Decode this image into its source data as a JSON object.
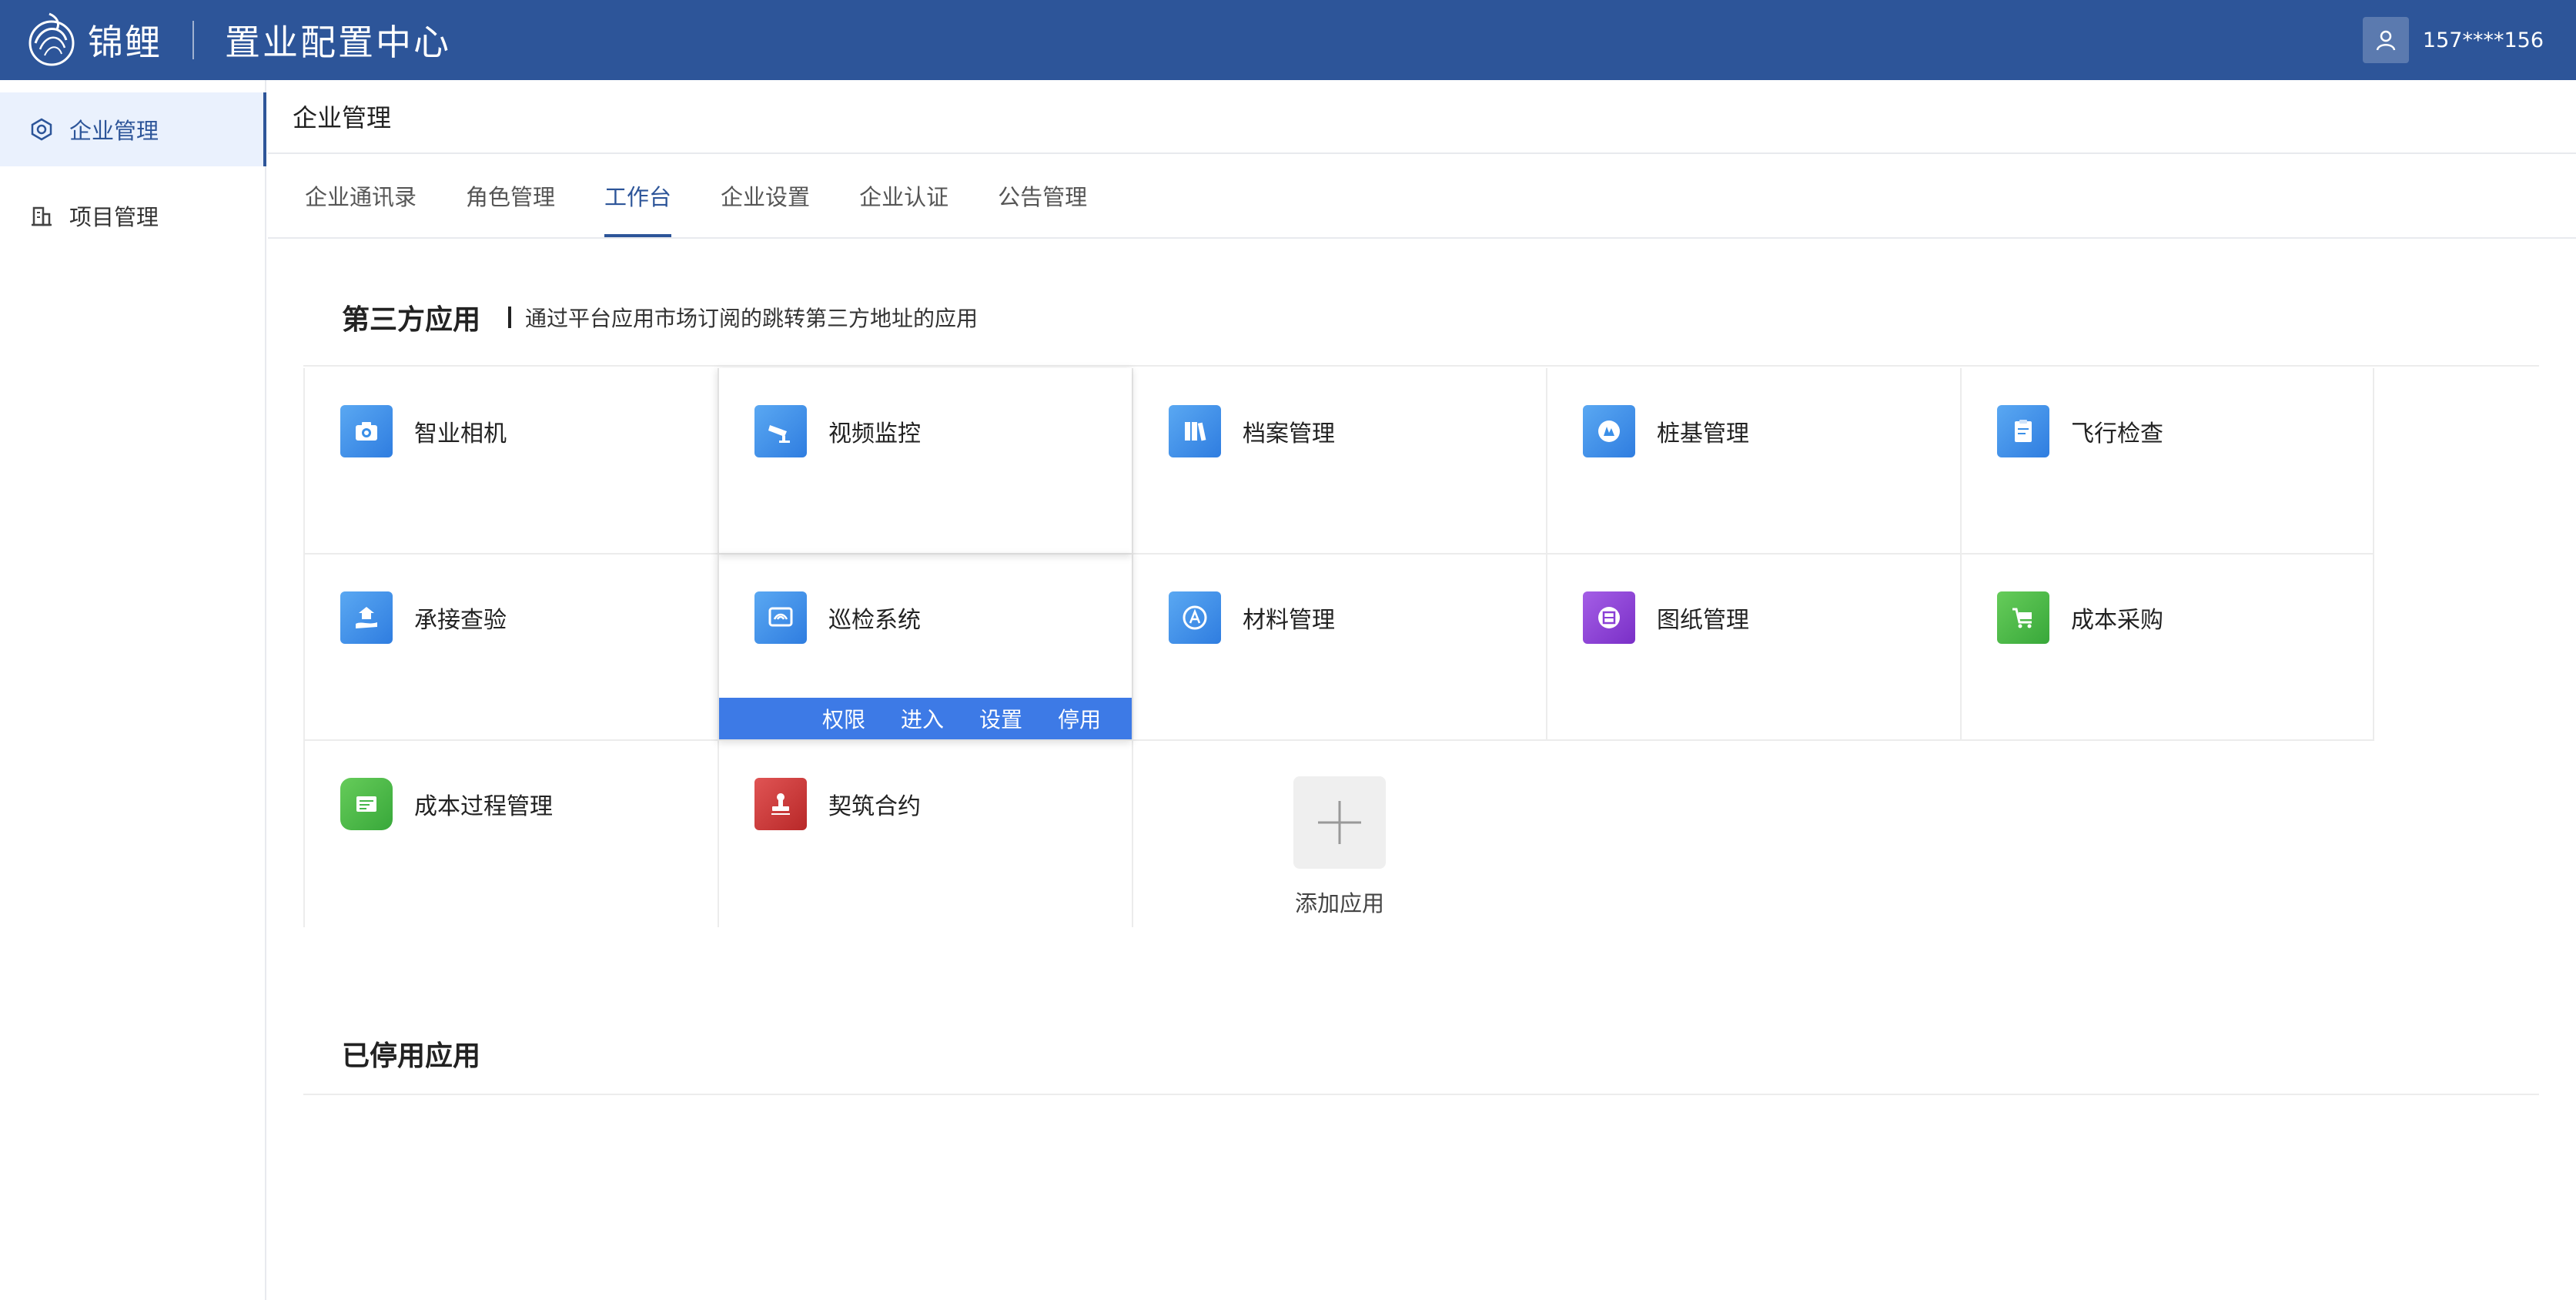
{
  "header": {
    "brand": "锦鲤",
    "system_title": "置业配置中心",
    "username": "157****156",
    "icons": {
      "logo": "koi-logo-icon",
      "user": "user-icon"
    }
  },
  "sidebar": {
    "items": [
      {
        "label": "企业管理",
        "icon": "enterprise-icon",
        "active": true
      },
      {
        "label": "项目管理",
        "icon": "building-icon",
        "active": false
      }
    ]
  },
  "main": {
    "page_title": "企业管理",
    "tabs": [
      {
        "label": "企业通讯录",
        "active": false
      },
      {
        "label": "角色管理",
        "active": false
      },
      {
        "label": "工作台",
        "active": true
      },
      {
        "label": "企业设置",
        "active": false
      },
      {
        "label": "企业认证",
        "active": false
      },
      {
        "label": "公告管理",
        "active": false
      }
    ],
    "third_party": {
      "title": "第三方应用",
      "description": "通过平台应用市场订阅的跳转第三方地址的应用"
    },
    "apps": [
      {
        "name": "智业相机",
        "icon": "camera-icon",
        "color": "#3a8fe8"
      },
      {
        "name": "视频监控",
        "icon": "surveillance-camera-icon",
        "color": "#3a8fe8"
      },
      {
        "name": "档案管理",
        "icon": "archive-binders-icon",
        "color": "#3a8fe8"
      },
      {
        "name": "桩基管理",
        "icon": "pile-foundation-icon",
        "color": "#3a8fe8"
      },
      {
        "name": "飞行检查",
        "icon": "clipboard-check-icon",
        "color": "#3a8fe8"
      },
      {
        "name": "承接查验",
        "icon": "hand-house-icon",
        "color": "#3a8fe8"
      },
      {
        "name": "巡检系统",
        "icon": "patrol-monitor-icon",
        "color": "#3a8fe8"
      },
      {
        "name": "材料管理",
        "icon": "material-badge-icon",
        "color": "#3a8fe8"
      },
      {
        "name": "图纸管理",
        "icon": "blueprint-icon",
        "color": "#8a3fd6"
      },
      {
        "name": "成本采购",
        "icon": "shopping-cart-icon",
        "color": "#45b84a"
      },
      {
        "name": "成本过程管理",
        "icon": "cost-list-icon",
        "color": "#45b84a"
      },
      {
        "name": "契筑合约",
        "icon": "seal-stamp-icon",
        "color": "#c93535"
      }
    ],
    "hover_actions": [
      "权限",
      "进入",
      "设置",
      "停用"
    ],
    "add_app_label": "添加应用",
    "disabled_section_title": "已停用应用"
  }
}
